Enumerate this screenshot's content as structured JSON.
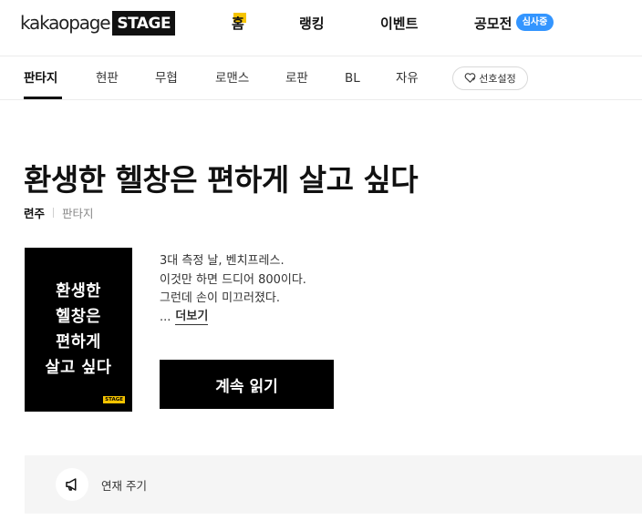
{
  "header": {
    "logo": {
      "word": "kakaopage",
      "stage": "STAGE"
    },
    "nav": [
      "홈",
      "랭킹",
      "이벤트",
      "공모전"
    ],
    "contest_badge": "심사중"
  },
  "genres": {
    "tabs": [
      "판타지",
      "현판",
      "무협",
      "로맨스",
      "로판",
      "BL",
      "자유"
    ],
    "active": "판타지",
    "preference_button": "선호설정"
  },
  "work": {
    "title": "환생한 헬창은 편하게 살고 싶다",
    "author": "련주",
    "genre": "판타지",
    "cover_lines": [
      "환생한",
      "헬창은",
      "편하게",
      "살고 싶다"
    ],
    "cover_stage_mark": "STAGE",
    "synopsis": [
      "3대 측정 날, 벤치프레스.",
      "이것만 하면 드디어 800이다.",
      "그런데 손이 미끄러졌다."
    ],
    "ellipsis": "...",
    "more_label": "더보기",
    "read_button": "계속 읽기"
  },
  "schedule": {
    "label": "연재 주기"
  },
  "colors": {
    "accent_yellow": "#f6c400",
    "badge_blue": "#3395ff",
    "black": "#000000"
  },
  "icons": {
    "preference": "heart-icon",
    "schedule": "megaphone-icon"
  }
}
